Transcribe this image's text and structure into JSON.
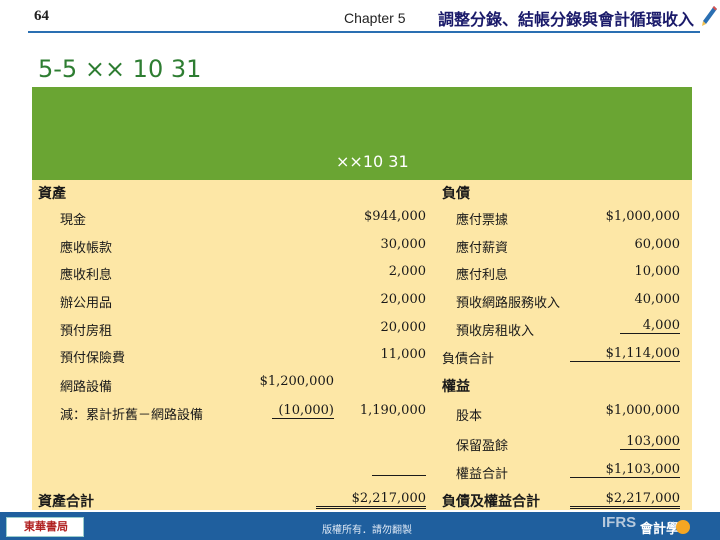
{
  "header": {
    "page_number": "64",
    "chapter": "Chapter 5",
    "title": "調整分錄、結帳分錄與會計循環收入",
    "pencil_icon": "pencil-icon"
  },
  "section_title": "5-5 ×× 10 31",
  "band_text": "××10 31",
  "table": {
    "assets_header": "資產",
    "liabilities_header": "負債",
    "assets": [
      {
        "label": "現金",
        "amount": "$944,000"
      },
      {
        "label": "應收帳款",
        "amount": "30,000"
      },
      {
        "label": "應收利息",
        "amount": "2,000"
      },
      {
        "label": "辦公用品",
        "amount": "20,000"
      },
      {
        "label": "預付房租",
        "amount": "20,000"
      },
      {
        "label": "預付保險費",
        "amount": "11,000"
      }
    ],
    "equipment": {
      "label": "網路設備",
      "gross": "$1,200,000",
      "contra_label": "減：累計折舊－網路設備",
      "contra": "(10,000)",
      "net": "1,190,000"
    },
    "liabilities": [
      {
        "label": "應付票據",
        "amount": "$1,000,000"
      },
      {
        "label": "應付薪資",
        "amount": "60,000"
      },
      {
        "label": "應付利息",
        "amount": "10,000"
      },
      {
        "label": "預收網路服務收入",
        "amount": "40,000"
      },
      {
        "label": "預收房租收入",
        "amount": "4,000"
      }
    ],
    "liabilities_total_label": "負債合計",
    "liabilities_total": "$1,114,000",
    "equity_header": "權益",
    "equity": [
      {
        "label": "股本",
        "amount": "$1,000,000"
      },
      {
        "label": "保留盈餘",
        "amount": "103,000"
      }
    ],
    "equity_total_label": "權益合計",
    "equity_total": "$1,103,000",
    "assets_total_label": "資產合計",
    "assets_total": "$2,217,000",
    "liab_equity_total_label": "負債及權益合計",
    "liab_equity_total": "$2,217,000"
  },
  "footer": {
    "publisher": "東華書局",
    "rights": "版權所有．請勿翻製",
    "ifrs": "IFRS",
    "subject": "會計學"
  },
  "colors": {
    "band": "#6aa533",
    "table_bg": "#fde7a6",
    "footer": "#1f5f9e",
    "section_title": "#2e7d32"
  }
}
